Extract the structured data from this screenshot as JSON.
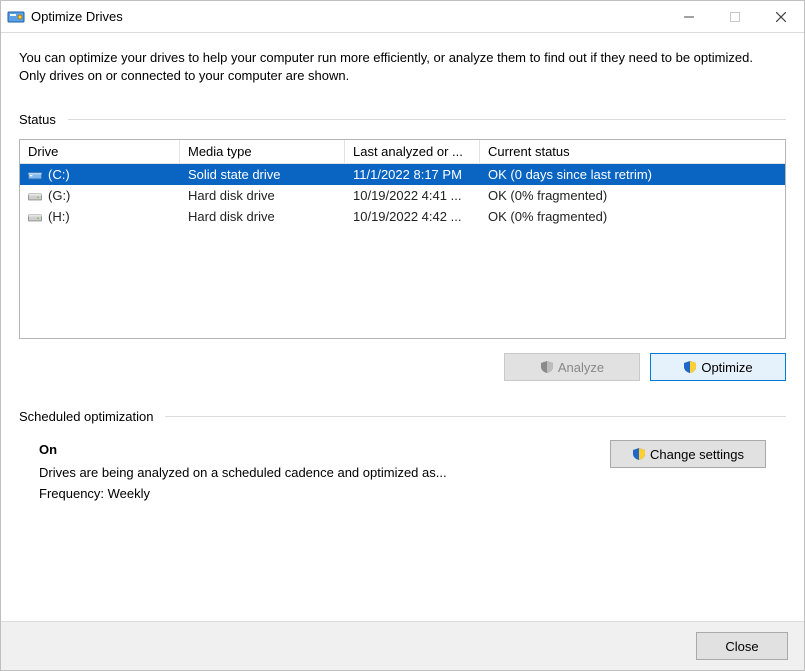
{
  "window": {
    "title": "Optimize Drives",
    "description": "You can optimize your drives to help your computer run more efficiently, or analyze them to find out if they need to be optimized. Only drives on or connected to your computer are shown."
  },
  "status_section": {
    "label": "Status",
    "columns": {
      "drive": "Drive",
      "media": "Media type",
      "last": "Last analyzed or ...",
      "status": "Current status"
    },
    "rows": [
      {
        "selected": true,
        "icon": "ssd",
        "drive": "(C:)",
        "media": "Solid state drive",
        "last": "11/1/2022 8:17 PM",
        "status": "OK (0 days since last retrim)"
      },
      {
        "selected": false,
        "icon": "hdd",
        "drive": "(G:)",
        "media": "Hard disk drive",
        "last": "10/19/2022 4:41 ...",
        "status": "OK (0% fragmented)"
      },
      {
        "selected": false,
        "icon": "hdd",
        "drive": "(H:)",
        "media": "Hard disk drive",
        "last": "10/19/2022 4:42 ...",
        "status": "OK (0% fragmented)"
      }
    ],
    "buttons": {
      "analyze": {
        "label": "Analyze",
        "enabled": false
      },
      "optimize": {
        "label": "Optimize",
        "enabled": true
      }
    }
  },
  "scheduled_section": {
    "label": "Scheduled optimization",
    "state": "On",
    "detail": "Drives are being analyzed on a scheduled cadence and optimized as...",
    "frequency": "Frequency: Weekly",
    "change_button": "Change settings"
  },
  "footer": {
    "close": "Close"
  }
}
